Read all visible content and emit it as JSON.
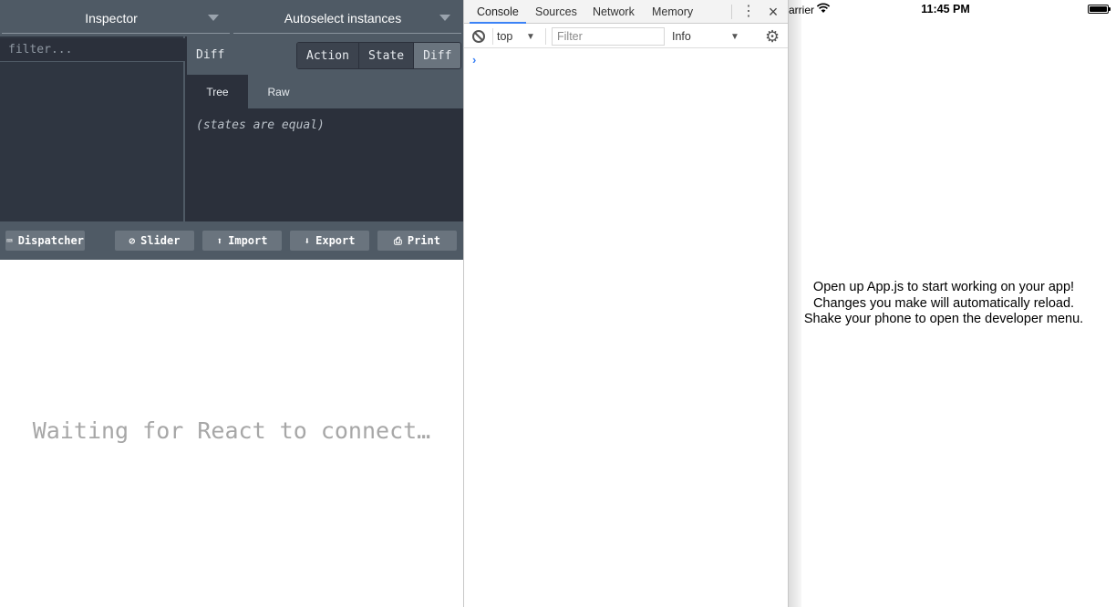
{
  "devtools": {
    "inspector_select": "Inspector",
    "instance_select": "Autoselect instances",
    "filter_placeholder": "filter...",
    "diff_title": "Diff",
    "modes": [
      "Action",
      "State",
      "Diff"
    ],
    "active_mode": "Diff",
    "subtabs": [
      "Tree",
      "Raw"
    ],
    "active_subtab": "Tree",
    "states_message": "(states are equal)",
    "buttons": {
      "dispatcher": "Dispatcher",
      "slider": "Slider",
      "import": "Import",
      "export": "Export",
      "print": "Print"
    },
    "waiting_message": "Waiting for React to connect…"
  },
  "console": {
    "tabs": [
      "Console",
      "Sources",
      "Network",
      "Memory"
    ],
    "active_tab": "Console",
    "context": "top",
    "filter_placeholder": "Filter",
    "level": "Info",
    "prompt": "›",
    "accent_color": "#3b82f6"
  },
  "simulator": {
    "carrier": "arrier",
    "time": "11:45 PM",
    "message_lines": [
      "Open up App.js to start working on your app!",
      "Changes you make will automatically reload.",
      "Shake your phone to open the developer menu."
    ]
  },
  "icons": {
    "dispatcher": "keyboard-icon",
    "slider": "clock-icon",
    "import": "upload-icon",
    "export": "download-icon",
    "print": "printer-icon",
    "clear": "no-entry-icon",
    "settings": "gear-icon",
    "status": [
      "wifi-icon",
      "battery-icon"
    ]
  }
}
